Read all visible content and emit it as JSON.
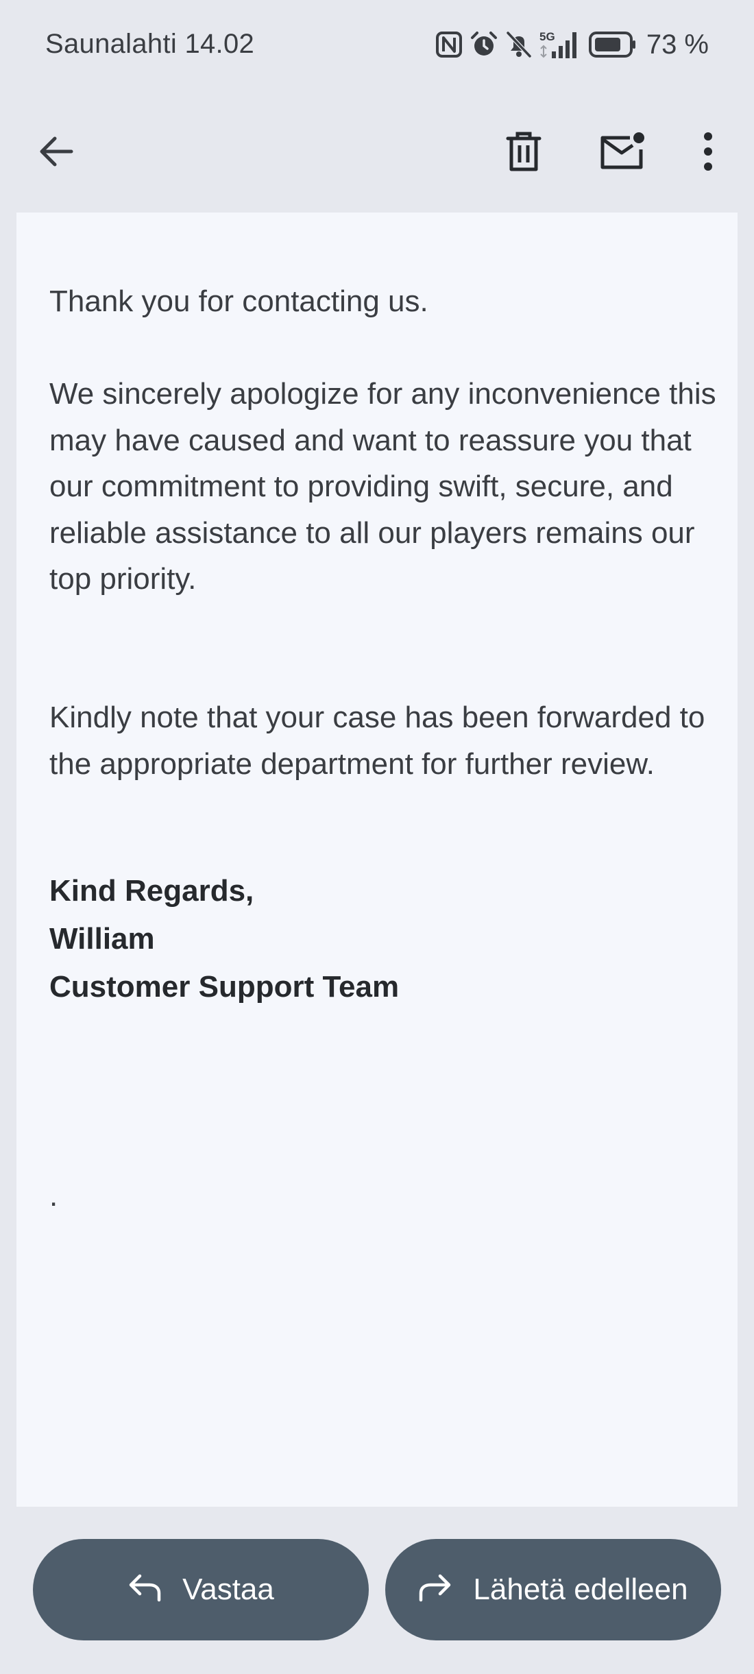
{
  "status_bar": {
    "carrier_time": "Saunalahti 14.02",
    "network": "5G",
    "battery": "73 %",
    "icons": [
      "nfc-icon",
      "alarm-icon",
      "muted-bell-icon",
      "signal-5g-icon",
      "battery-icon"
    ]
  },
  "toolbar": {
    "icons": [
      "back-arrow-icon",
      "trash-icon",
      "mark-unread-icon",
      "more-vert-icon"
    ]
  },
  "email": {
    "paragraph1": "Thank you for contacting us.",
    "paragraph2": "We sincerely apologize for any inconvenience this may have caused and want to reassure you that our commitment to providing swift, secure, and reliable assistance to all our players remains our top priority.",
    "paragraph3": "Kindly note that your case has been forwarded to the appropriate department for further review.",
    "signature": {
      "closing": "Kind Regards,",
      "name": "William",
      "team": "Customer Support Team"
    },
    "trailing": "."
  },
  "actions": {
    "reply_label": "Vastaa",
    "forward_label": "Lähetä edelleen"
  },
  "colors": {
    "background": "#e6e8ee",
    "card": "#f5f7fc",
    "button": "#4e5d6b",
    "text": "#3a3d42"
  }
}
